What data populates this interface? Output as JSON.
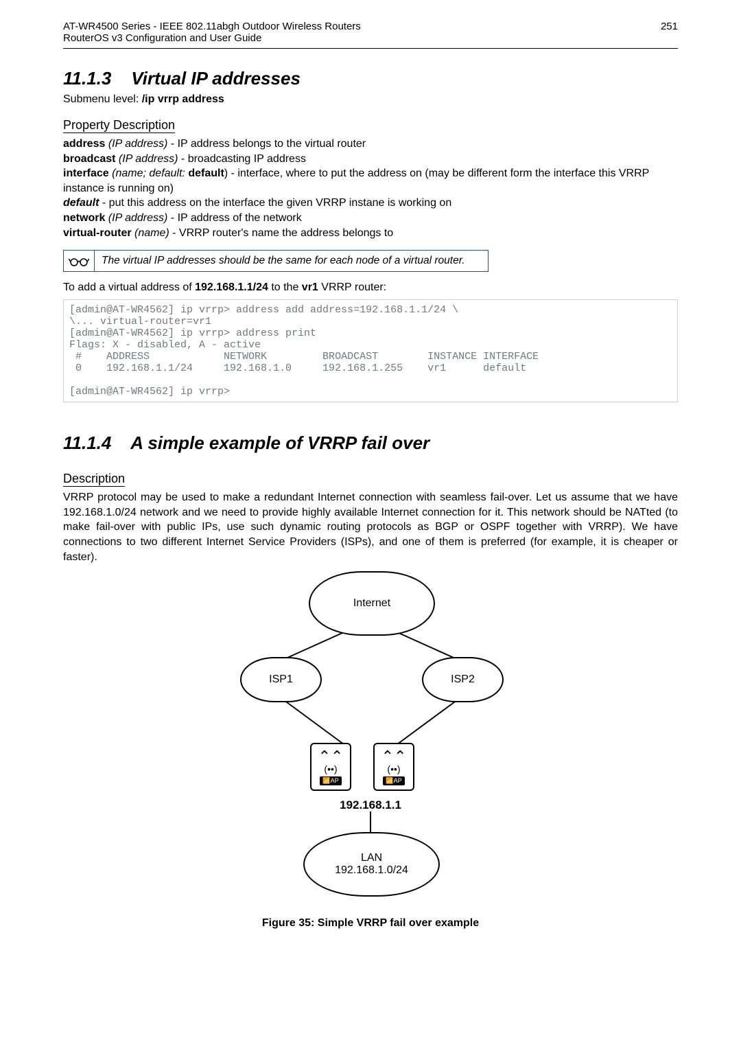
{
  "header": {
    "title_l1": "AT-WR4500 Series - IEEE 802.11abgh Outdoor Wireless Routers",
    "title_l2": "RouterOS v3 Configuration and User Guide",
    "page_no": "251"
  },
  "sec_11_1_3": {
    "num": "11.1.3",
    "title": "Virtual IP addresses",
    "submenu_label": "Submenu level: ",
    "submenu_cmd": "/ip vrrp address",
    "prop_head": "Property Description",
    "props": {
      "address_b": "address",
      "address_args": " (IP address)",
      "address_txt": " - IP address belongs to the virtual router",
      "broadcast_b": "broadcast",
      "broadcast_args": " (IP address)",
      "broadcast_txt": " - broadcasting IP address",
      "interface_b": "interface",
      "interface_args": " (name; default: ",
      "interface_def": "default",
      "interface_txt": ") - interface, where to put the address on (may be different form the interface this VRRP instance is running on)",
      "default_b": "default",
      "default_txt": " - put this address on the interface the given VRRP instane is working on",
      "network_b": "network",
      "network_args": " (IP address)",
      "network_txt": " - IP address of the network",
      "vrouter_b": "virtual-router",
      "vrouter_args": " (name)",
      "vrouter_txt": " - VRRP router's name the address belongs to"
    },
    "callout": "The virtual IP addresses should be the same for each node of a virtual router.",
    "example_pre": "To add a virtual address of ",
    "example_ip": "192.168.1.1/24",
    "example_mid": " to the ",
    "example_vr": "vr1",
    "example_post": " VRRP router:",
    "terminal": "[admin@AT-WR4562] ip vrrp> address add address=192.168.1.1/24 \\\n\\... virtual-router=vr1\n[admin@AT-WR4562] ip vrrp> address print\nFlags: X - disabled, A - active\n #    ADDRESS            NETWORK         BROADCAST        INSTANCE INTERFACE\n 0    192.168.1.1/24     192.168.1.0     192.168.1.255    vr1      default\n\n[admin@AT-WR4562] ip vrrp>"
  },
  "sec_11_1_4": {
    "num": "11.1.4",
    "title": "A simple example of VRRP fail over",
    "desc_head": "Description",
    "body": "VRRP protocol may be used to make a redundant Internet connection with seamless fail-over. Let us assume that we have 192.168.1.0/24 network and we need to provide highly available Internet connection for it. This network should be NATted (to make fail-over with public IPs, use such dynamic routing protocols as BGP or OSPF together with VRRP). We have connections to two different Internet Service Providers (ISPs), and one of them is preferred (for example, it is cheaper or faster).",
    "diagram": {
      "internet": "Internet",
      "isp1": "ISP1",
      "isp2": "ISP2",
      "ap": "AP",
      "ip": "192.168.1.1",
      "lan": "LAN",
      "net": "192.168.1.0/24"
    },
    "caption": "Figure 35: Simple VRRP fail over example"
  }
}
